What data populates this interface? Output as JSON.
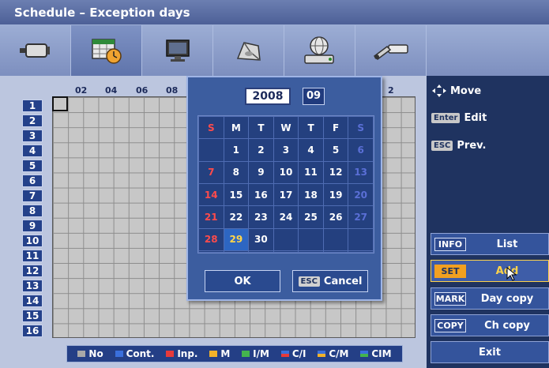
{
  "window": {
    "title": "Schedule – Exception days"
  },
  "tabs": [
    {
      "icon": "camera-icon"
    },
    {
      "icon": "calendar-clock-icon",
      "active": true
    },
    {
      "icon": "monitor-icon"
    },
    {
      "icon": "storage-icon"
    },
    {
      "icon": "network-icon"
    },
    {
      "icon": "tools-icon"
    }
  ],
  "grid": {
    "hours": [
      "02",
      "04",
      "06",
      "08",
      "2"
    ],
    "rows": [
      "1",
      "2",
      "3",
      "4",
      "5",
      "6",
      "7",
      "8",
      "9",
      "10",
      "11",
      "12",
      "13",
      "14",
      "15",
      "16"
    ]
  },
  "legend": [
    {
      "label": "No",
      "color": "#a8a8a8"
    },
    {
      "label": "Cont.",
      "color": "#3a6fdc"
    },
    {
      "label": "Inp.",
      "color": "#e83a3a"
    },
    {
      "label": "M",
      "color": "#f2b22a"
    },
    {
      "label": "I/M",
      "color": "#44b44e"
    },
    {
      "label": "C/I",
      "color": "#e83a3a"
    },
    {
      "label": "C/M",
      "color": "#f2b22a"
    },
    {
      "label": "CIM",
      "color": "#3aa0c8"
    }
  ],
  "help": {
    "move": "Move",
    "enter_key": "Enter",
    "edit": "Edit",
    "esc_key": "ESC",
    "prev": "Prev."
  },
  "buttons": {
    "info_key": "INFO",
    "list": "List",
    "set_key": "SET",
    "add": "Add",
    "mark_key": "MARK",
    "day_copy": "Day copy",
    "copy_key": "COPY",
    "ch_copy": "Ch copy",
    "exit": "Exit"
  },
  "calendar": {
    "year": "2008",
    "month": "09",
    "weekdays": [
      "S",
      "M",
      "T",
      "W",
      "T",
      "F",
      "S"
    ],
    "weeks": [
      [
        "",
        "1",
        "2",
        "3",
        "4",
        "5",
        "6"
      ],
      [
        "7",
        "8",
        "9",
        "10",
        "11",
        "12",
        "13"
      ],
      [
        "14",
        "15",
        "16",
        "17",
        "18",
        "19",
        "20"
      ],
      [
        "21",
        "22",
        "23",
        "24",
        "25",
        "26",
        "27"
      ],
      [
        "28",
        "29",
        "30",
        "",
        "",
        "",
        ""
      ],
      [
        "",
        "",
        "",
        "",
        "",
        "",
        ""
      ]
    ],
    "today": "29",
    "ok": "OK",
    "cancel_key": "ESC",
    "cancel": "Cancel"
  }
}
